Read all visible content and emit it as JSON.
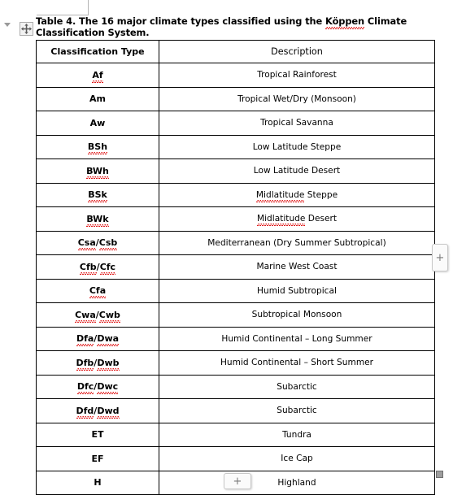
{
  "document": {
    "caption": "Table 4. The 16 major climate types classified using the Köppen Climate Classification System.",
    "caption_misspelled_word": "Köppen"
  },
  "controls": {
    "move_handle_icon": "move-four-arrows-icon",
    "collapse_toggle_icon": "triangle-down-icon",
    "insert_column_label": "+",
    "insert_row_label": "+",
    "resize_handle_icon": "resize-corner-icon"
  },
  "table": {
    "headers": [
      "Classification Type",
      "Description"
    ],
    "rows": [
      {
        "code": "Af",
        "code_misspelled": true,
        "description": "Tropical Rainforest",
        "desc_misspelled_word": ""
      },
      {
        "code": "Am",
        "code_misspelled": false,
        "description": "Tropical Wet/Dry (Monsoon)",
        "desc_misspelled_word": ""
      },
      {
        "code": "Aw",
        "code_misspelled": false,
        "description": "Tropical Savanna",
        "desc_misspelled_word": ""
      },
      {
        "code": "BSh",
        "code_misspelled": true,
        "description": "Low Latitude Steppe",
        "desc_misspelled_word": ""
      },
      {
        "code": "BWh",
        "code_misspelled": true,
        "description": "Low Latitude Desert",
        "desc_misspelled_word": ""
      },
      {
        "code": "BSk",
        "code_misspelled": true,
        "description": "Midlatitude Steppe",
        "desc_misspelled_word": "Midlatitude"
      },
      {
        "code": "BWk",
        "code_misspelled": true,
        "description": "Midlatitude Desert",
        "desc_misspelled_word": "Midlatitude"
      },
      {
        "code": "Csa/Csb",
        "code_misspelled": true,
        "description": "Mediterranean (Dry Summer Subtropical)",
        "desc_misspelled_word": ""
      },
      {
        "code": "Cfb/Cfc",
        "code_misspelled": true,
        "description": "Marine West Coast",
        "desc_misspelled_word": ""
      },
      {
        "code": "Cfa",
        "code_misspelled": true,
        "description": "Humid Subtropical",
        "desc_misspelled_word": ""
      },
      {
        "code": "Cwa/Cwb",
        "code_misspelled": true,
        "description": "Subtropical Monsoon",
        "desc_misspelled_word": ""
      },
      {
        "code": "Dfa/Dwa",
        "code_misspelled": true,
        "description": "Humid Continental – Long Summer",
        "desc_misspelled_word": ""
      },
      {
        "code": "Dfb/Dwb",
        "code_misspelled": true,
        "description": "Humid Continental – Short Summer",
        "desc_misspelled_word": ""
      },
      {
        "code": "Dfc/Dwc",
        "code_misspelled": true,
        "description": "Subarctic",
        "desc_misspelled_word": ""
      },
      {
        "code": "Dfd/Dwd",
        "code_misspelled": true,
        "description": "Subarctic",
        "desc_misspelled_word": ""
      },
      {
        "code": "ET",
        "code_misspelled": false,
        "description": "Tundra",
        "desc_misspelled_word": ""
      },
      {
        "code": "EF",
        "code_misspelled": false,
        "description": "Ice Cap",
        "desc_misspelled_word": ""
      },
      {
        "code": "H",
        "code_misspelled": false,
        "description": "Highland",
        "desc_misspelled_word": ""
      }
    ]
  },
  "colors": {
    "spellcheck_underline": "#e01b1b",
    "table_border": "#000000",
    "text": "#000000",
    "control_border": "#c8c8c8"
  }
}
